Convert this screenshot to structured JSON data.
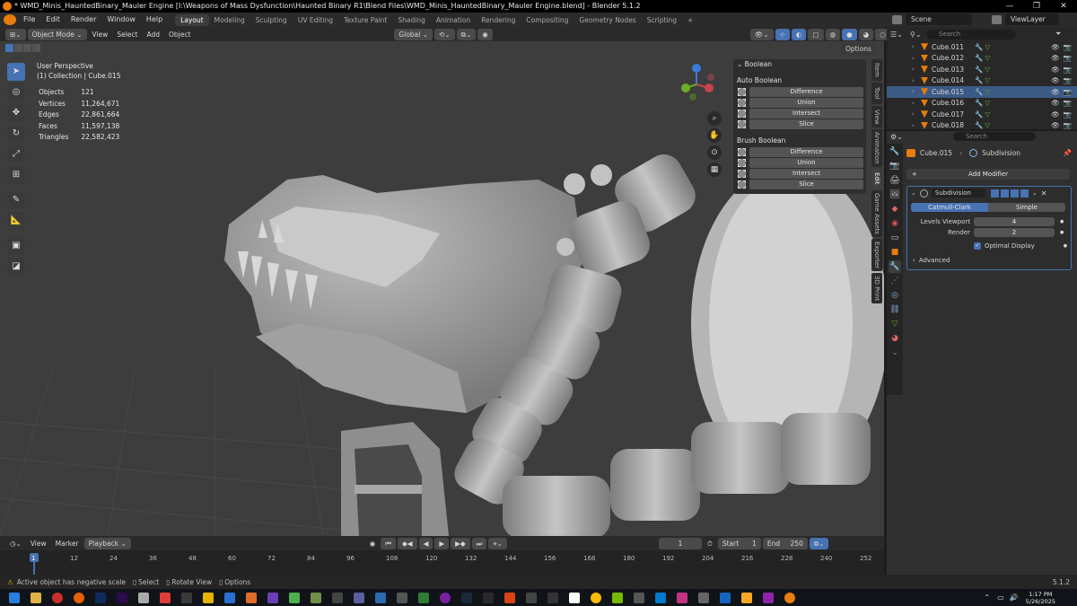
{
  "window": {
    "title": "* WMD_Minis_HauntedBinary_Mauler Engine [I:\\Weapons of Mass Dysfunction\\Haunted Binary R1\\Blend Files\\WMD_Minis_HauntedBinary_Mauler Engine.blend] - Blender 5.1.2",
    "minimize": "—",
    "maximize": "❐",
    "close": "✕"
  },
  "menu": [
    "File",
    "Edit",
    "Render",
    "Window",
    "Help"
  ],
  "workspaces": [
    "Layout",
    "Modeling",
    "Sculpting",
    "UV Editing",
    "Texture Paint",
    "Shading",
    "Animation",
    "Rendering",
    "Compositing",
    "Geometry Nodes",
    "Scripting"
  ],
  "workspace_add": "+",
  "scene": {
    "label": "Scene",
    "viewlayer": "ViewLayer"
  },
  "viewport_header": {
    "mode": "Object Mode",
    "menus": [
      "View",
      "Select",
      "Add",
      "Object"
    ],
    "transform": "Global",
    "options": "Options"
  },
  "overlay_text": {
    "perspective": "User Perspective",
    "collection": "(1) Collection | Cube.015"
  },
  "stats": [
    {
      "label": "Objects",
      "value": "121"
    },
    {
      "label": "Vertices",
      "value": "11,264,671"
    },
    {
      "label": "Edges",
      "value": "22,861,664"
    },
    {
      "label": "Faces",
      "value": "11,597,138"
    },
    {
      "label": "Triangles",
      "value": "22,582,423"
    }
  ],
  "boolean_panel": {
    "title": "Boolean",
    "auto_header": "Auto Boolean",
    "auto_buttons": [
      "Difference",
      "Union",
      "Intersect",
      "Slice"
    ],
    "brush_header": "Brush Boolean",
    "brush_buttons": [
      "Difference",
      "Union",
      "Intersect",
      "Slice"
    ]
  },
  "side_tabs": [
    "Item",
    "Tool",
    "View",
    "Animation",
    "Edit",
    "Game Assets",
    "Exporter",
    "3D Print"
  ],
  "outliner": {
    "rows": [
      {
        "name": "Cube.011",
        "selected": false
      },
      {
        "name": "Cube.012",
        "selected": false
      },
      {
        "name": "Cube.013",
        "selected": false
      },
      {
        "name": "Cube.014",
        "selected": false
      },
      {
        "name": "Cube.015",
        "selected": true
      },
      {
        "name": "Cube.016",
        "selected": false
      },
      {
        "name": "Cube.017",
        "selected": false
      },
      {
        "name": "Cube.018",
        "selected": false
      }
    ]
  },
  "properties": {
    "search_placeholder": "Search",
    "object": "Cube.015",
    "modifier_breadcrumb": "Subdivision",
    "add_modifier": "Add Modifier",
    "modifier_name": "Subdivision",
    "algo_catmull": "Catmull-Clark",
    "algo_simple": "Simple",
    "levels_label": "Levels Viewport",
    "levels_value": "4",
    "render_label": "Render",
    "render_value": "2",
    "optimal": "Optimal Display",
    "advanced": "Advanced"
  },
  "timeline": {
    "menus": [
      "View",
      "Marker"
    ],
    "playback": "Playback",
    "current_frame": "1",
    "start_label": "Start",
    "start_value": "1",
    "end_label": "End",
    "end_value": "250",
    "ticks": [
      "1",
      "12",
      "24",
      "36",
      "48",
      "60",
      "72",
      "84",
      "96",
      "108",
      "120",
      "132",
      "144",
      "156",
      "168",
      "180",
      "192",
      "204",
      "216",
      "228",
      "240",
      "252"
    ]
  },
  "status": {
    "warning": "Active object has negative scale",
    "select": "Select",
    "rotate": "Rotate View",
    "options": "Options",
    "version": "5.1.2"
  },
  "taskbar": {
    "time": "1:17 PM",
    "date": "5/26/2025"
  },
  "colors": {
    "accent": "#4772b3",
    "background": "#3d3d3d",
    "axis_x": "#c8434c",
    "axis_y": "#6da92a",
    "axis_z": "#3b7ad8"
  }
}
